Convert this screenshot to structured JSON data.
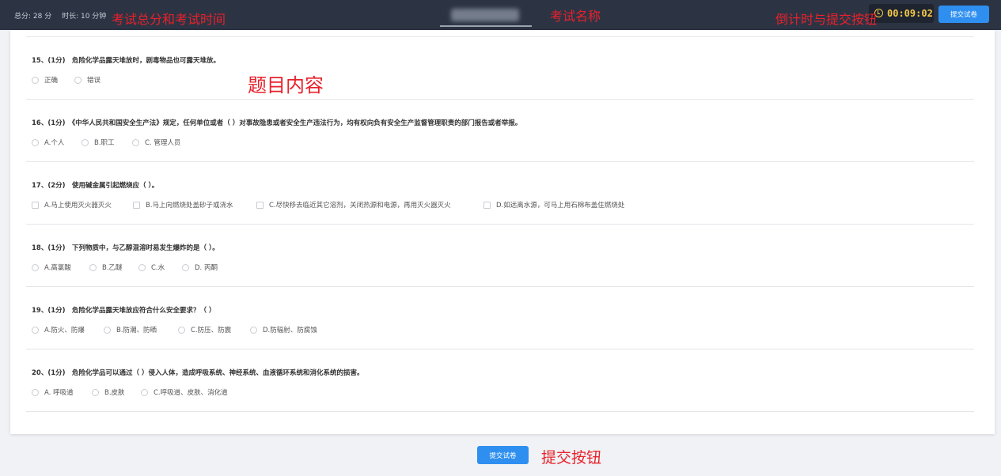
{
  "header": {
    "total_score": "总分: 28 分",
    "duration": "时长: 10 分钟",
    "timer": "00:09:02",
    "submit_label": "提交试卷"
  },
  "annotations": {
    "score_time": "考试总分和考试时间",
    "exam_name": "考试名称",
    "timer_submit": "倒计时与提交按钮",
    "question_content": "题目内容",
    "submit_button": "提交按钮"
  },
  "questions": [
    {
      "title": "15、(1分)　危险化学品露天堆放时，剧毒物品也可露天堆放。",
      "type": "radio",
      "options": [
        "正确",
        "错误"
      ]
    },
    {
      "title": "16、(1分)　《中华人民共和国安全生产法》规定，任何单位或者（ ）对事故隐患或者安全生产违法行为，均有权向负有安全生产监督管理职责的部门报告或者举报。",
      "type": "radio",
      "options": [
        "A.个人",
        "B.职工",
        "C. 管理人员"
      ]
    },
    {
      "title": "17、(2分)　使用碱金属引起燃烧应（ ）。",
      "type": "checkbox",
      "options": [
        "A.马上使用灭火器灭火",
        "B.马上向燃烧处盖砂子或浇水",
        "C.尽快移去临近其它溶剂，关闭热源和电源，再用灭火器灭火",
        "D.如远离水源，可马上用石棉布盖住燃烧处"
      ]
    },
    {
      "title": "18、(1分)　下列物质中，与乙醇混溶时易发生爆炸的是（ ）。",
      "type": "radio",
      "options": [
        "A.高氯酸",
        "B.乙醚",
        "C.水",
        "D. 丙酮"
      ]
    },
    {
      "title": "19、(1分)　危险化学品露天堆放应符合什么安全要求？（ ）",
      "type": "radio",
      "options": [
        "A.防火、防爆",
        "B.防潮、防晒",
        "C.防压、防震",
        "D.防辐射、防腐蚀"
      ]
    },
    {
      "title": "20、(1分)　危险化学品可以通过（ ）侵入人体，造成呼吸系统、神经系统、血液循环系统和消化系统的损害。",
      "type": "radio",
      "options": [
        "A. 呼吸道",
        "B.皮肤",
        "C.呼吸道、皮肤、消化道"
      ]
    }
  ],
  "footer": {
    "submit_label": "提交试卷"
  }
}
